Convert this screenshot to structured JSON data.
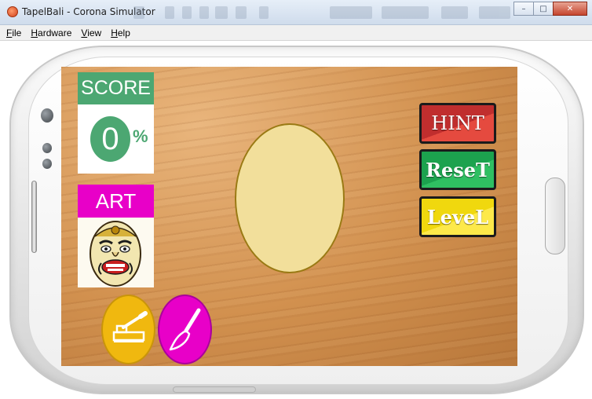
{
  "window": {
    "title": "TapelBali - Corona Simulator",
    "controls": {
      "minimize": "–",
      "maximize": "□",
      "close": "✕"
    }
  },
  "menu": {
    "items": [
      {
        "label": "File",
        "accel": "F",
        "rest": "ile"
      },
      {
        "label": "Hardware",
        "accel": "H",
        "rest": "ardware"
      },
      {
        "label": "View",
        "accel": "V",
        "rest": "iew"
      },
      {
        "label": "Help",
        "accel": "H",
        "rest": "elp"
      }
    ]
  },
  "game": {
    "score": {
      "label": "SCORE",
      "value": "0",
      "unit": "%"
    },
    "art": {
      "label": "ART"
    },
    "buttons": {
      "hint": "HINT",
      "reset": "ReseT",
      "level": "LeveL"
    },
    "tools": {
      "chisel": "chisel-icon",
      "brush": "brush-icon"
    }
  },
  "colors": {
    "score_green": "#4ca772",
    "art_magenta": "#e800c8",
    "hint_red": "#c02e2e",
    "reset_green": "#1ca24e",
    "level_yellow": "#f0d80e",
    "chisel_yellow": "#f0b80f",
    "face_cream": "#f2df9b"
  }
}
